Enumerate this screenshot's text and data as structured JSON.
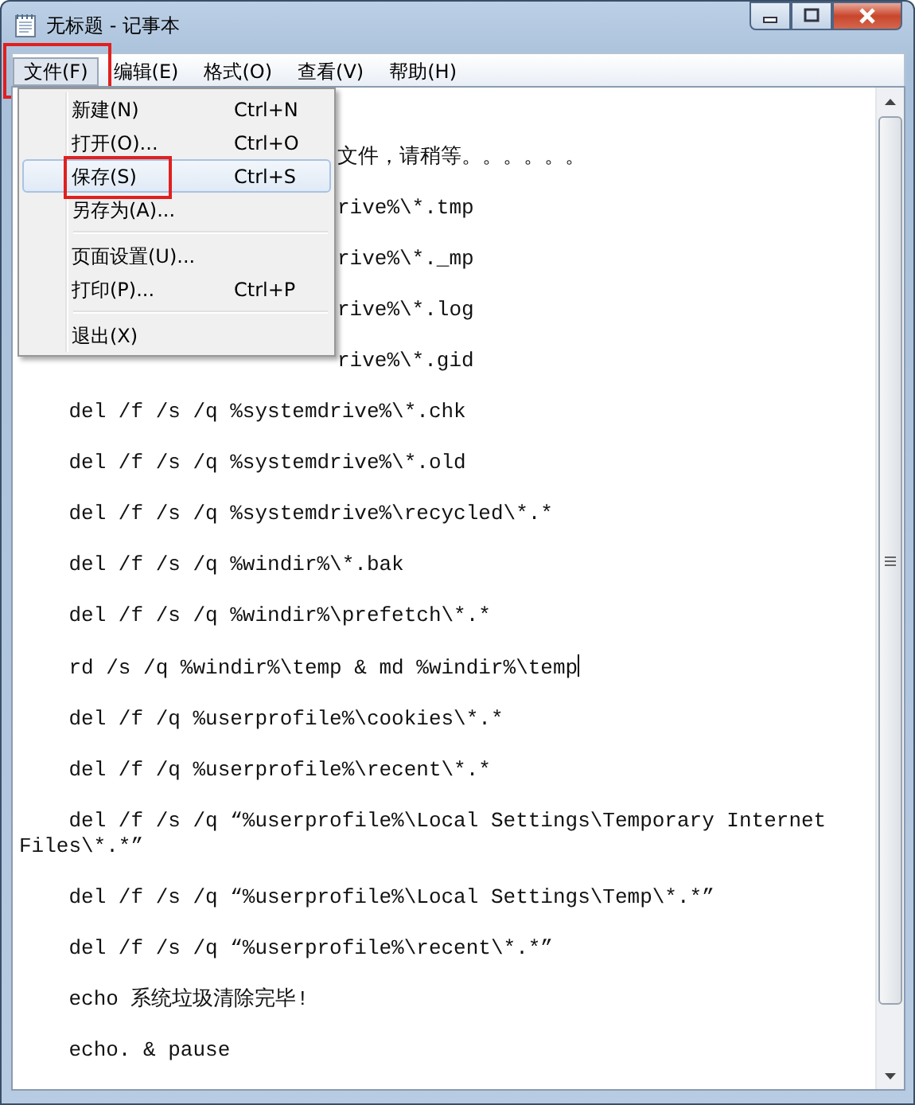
{
  "window": {
    "title": "无标题 - 记事本"
  },
  "menu_bar": [
    {
      "label": "文件(F)",
      "selected": true,
      "annotated": true
    },
    {
      "label": "编辑(E)",
      "selected": false,
      "annotated": false
    },
    {
      "label": "格式(O)",
      "selected": false,
      "annotated": false
    },
    {
      "label": "查看(V)",
      "selected": false,
      "annotated": false
    },
    {
      "label": "帮助(H)",
      "selected": false,
      "annotated": false
    }
  ],
  "file_menu": [
    {
      "kind": "item",
      "label": "新建(N)",
      "shortcut": "Ctrl+N",
      "selected": false,
      "annotated": false
    },
    {
      "kind": "item",
      "label": "打开(O)...",
      "shortcut": "Ctrl+O",
      "selected": false,
      "annotated": false
    },
    {
      "kind": "item",
      "label": "保存(S)",
      "shortcut": "Ctrl+S",
      "selected": true,
      "annotated": true
    },
    {
      "kind": "item",
      "label": "另存为(A)...",
      "selected": false,
      "annotated": false
    },
    {
      "kind": "separator"
    },
    {
      "kind": "item",
      "label": "页面设置(U)...",
      "selected": false,
      "annotated": false
    },
    {
      "kind": "item",
      "label": "打印(P)...",
      "shortcut": "Ctrl+P",
      "selected": false,
      "annotated": false
    },
    {
      "kind": "separator"
    },
    {
      "kind": "item",
      "label": "退出(X)",
      "selected": false,
      "annotated": false
    }
  ],
  "editor_lines": [
    {
      "kind": "covered",
      "text": "文件，请稍等。。。。。。"
    },
    {
      "kind": "covered",
      "text": "rive%\\*.tmp"
    },
    {
      "kind": "covered",
      "text": "rive%\\*._mp"
    },
    {
      "kind": "covered",
      "text": "rive%\\*.log"
    },
    {
      "kind": "covered",
      "text": "rive%\\*.gid"
    },
    {
      "kind": "full",
      "text": "    del /f /s /q %systemdrive%\\*.chk"
    },
    {
      "kind": "full",
      "text": "    del /f /s /q %systemdrive%\\*.old"
    },
    {
      "kind": "full",
      "text": "    del /f /s /q %systemdrive%\\recycled\\*.*"
    },
    {
      "kind": "full",
      "text": "    del /f /s /q %windir%\\*.bak"
    },
    {
      "kind": "full",
      "text": "    del /f /s /q %windir%\\prefetch\\*.*"
    },
    {
      "kind": "full",
      "text": "    rd /s /q %windir%\\temp & md %windir%\\temp",
      "caret": true
    },
    {
      "kind": "full",
      "text": "    del /f /q %userprofile%\\cookies\\*.*"
    },
    {
      "kind": "full",
      "text": "    del /f /q %userprofile%\\recent\\*.*"
    },
    {
      "kind": "full",
      "text": "    del /f /s /q “%userprofile%\\Local Settings\\Temporary Internet Files\\*.*”"
    },
    {
      "kind": "full",
      "text": "    del /f /s /q “%userprofile%\\Local Settings\\Temp\\*.*”"
    },
    {
      "kind": "full",
      "text": "    del /f /s /q “%userprofile%\\recent\\*.*”"
    },
    {
      "kind": "full",
      "text": "    echo 系统垃圾清除完毕!"
    },
    {
      "kind": "full",
      "text": "    echo. & pause"
    }
  ]
}
